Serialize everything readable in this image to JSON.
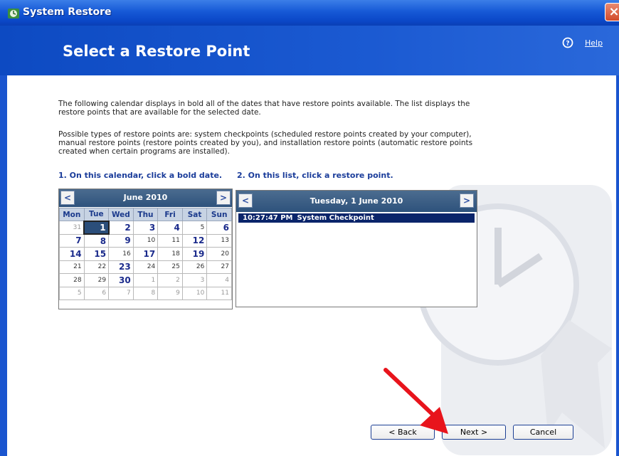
{
  "window": {
    "title": "System Restore"
  },
  "header": {
    "title": "Select a Restore Point",
    "help_label": "Help"
  },
  "intro": {
    "paragraph1": "The following calendar displays in bold all of the dates that have restore points available. The list displays the restore points that are available for the selected date.",
    "paragraph2": "Possible types of restore points are: system checkpoints (scheduled restore points created by your computer), manual restore points (restore points created by you), and installation restore points (automatic restore points created when certain programs are installed)."
  },
  "steps": {
    "step1": "1. On this calendar, click a bold date.",
    "step2": "2. On this list, click a restore point."
  },
  "calendar": {
    "month_label": "June 2010",
    "prev_label": "<",
    "next_label": ">",
    "weekdays": [
      "Mon",
      "Tue",
      "Wed",
      "Thu",
      "Fri",
      "Sat",
      "Sun"
    ],
    "weeks": [
      [
        {
          "d": "31",
          "t": "other"
        },
        {
          "d": "1",
          "t": "selected"
        },
        {
          "d": "2",
          "t": "bold"
        },
        {
          "d": "3",
          "t": "bold"
        },
        {
          "d": "4",
          "t": "bold"
        },
        {
          "d": "5",
          "t": "normal"
        },
        {
          "d": "6",
          "t": "bold"
        }
      ],
      [
        {
          "d": "7",
          "t": "bold"
        },
        {
          "d": "8",
          "t": "bold"
        },
        {
          "d": "9",
          "t": "bold"
        },
        {
          "d": "10",
          "t": "normal"
        },
        {
          "d": "11",
          "t": "normal"
        },
        {
          "d": "12",
          "t": "bold"
        },
        {
          "d": "13",
          "t": "normal"
        }
      ],
      [
        {
          "d": "14",
          "t": "bold"
        },
        {
          "d": "15",
          "t": "bold"
        },
        {
          "d": "16",
          "t": "normal"
        },
        {
          "d": "17",
          "t": "bold"
        },
        {
          "d": "18",
          "t": "normal"
        },
        {
          "d": "19",
          "t": "bold"
        },
        {
          "d": "20",
          "t": "normal"
        }
      ],
      [
        {
          "d": "21",
          "t": "normal"
        },
        {
          "d": "22",
          "t": "normal"
        },
        {
          "d": "23",
          "t": "bold"
        },
        {
          "d": "24",
          "t": "normal"
        },
        {
          "d": "25",
          "t": "normal"
        },
        {
          "d": "26",
          "t": "normal"
        },
        {
          "d": "27",
          "t": "normal"
        }
      ],
      [
        {
          "d": "28",
          "t": "normal"
        },
        {
          "d": "29",
          "t": "normal"
        },
        {
          "d": "30",
          "t": "bold"
        },
        {
          "d": "1",
          "t": "other"
        },
        {
          "d": "2",
          "t": "other"
        },
        {
          "d": "3",
          "t": "other"
        },
        {
          "d": "4",
          "t": "other"
        }
      ],
      [
        {
          "d": "5",
          "t": "other"
        },
        {
          "d": "6",
          "t": "other"
        },
        {
          "d": "7",
          "t": "other"
        },
        {
          "d": "8",
          "t": "other"
        },
        {
          "d": "9",
          "t": "other"
        },
        {
          "d": "10",
          "t": "other"
        },
        {
          "d": "11",
          "t": "other"
        }
      ]
    ]
  },
  "restore_list": {
    "date_label": "Tuesday, 1 June 2010",
    "prev_label": "<",
    "next_label": ">",
    "items": [
      {
        "time": "10:27:47 PM",
        "description": "System Checkpoint",
        "selected": true
      }
    ]
  },
  "buttons": {
    "back": "< Back",
    "next": "Next >",
    "cancel": "Cancel"
  },
  "colors": {
    "titlebar": "#1659d6",
    "header": "#1b5ad2",
    "selection": "#0a246a",
    "annotation_arrow": "#e8141c"
  },
  "icons": {
    "title_icon": "system-restore-icon",
    "help_icon": "question-circle-icon",
    "watermark": "clock-restore-watermark",
    "annotation": "red-arrow-annotation"
  }
}
